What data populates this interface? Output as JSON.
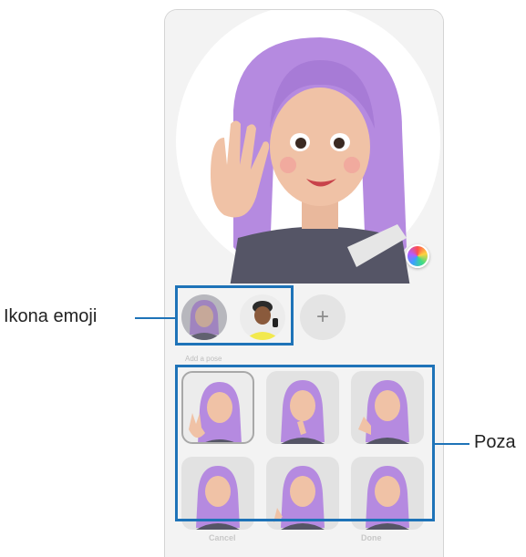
{
  "callouts": {
    "emoji_icon_label": "Ikona emoji",
    "pose_label": "Poza"
  },
  "colors": {
    "callout": "#1e73b8",
    "avatar_hair": "#b58ae0",
    "avatar_skin": "#f0c2a6",
    "avatar_shirt": "#555566"
  },
  "panel": {
    "palette_button_icon": "color-palette-icon",
    "emoji_list": [
      {
        "name": "avatar-emoji-1",
        "selected": true
      },
      {
        "name": "avatar-emoji-2",
        "selected": false
      }
    ],
    "add_button_glyph": "+",
    "section_label": "Add a pose",
    "cancel_label": "Cancel",
    "done_label": "Done"
  }
}
